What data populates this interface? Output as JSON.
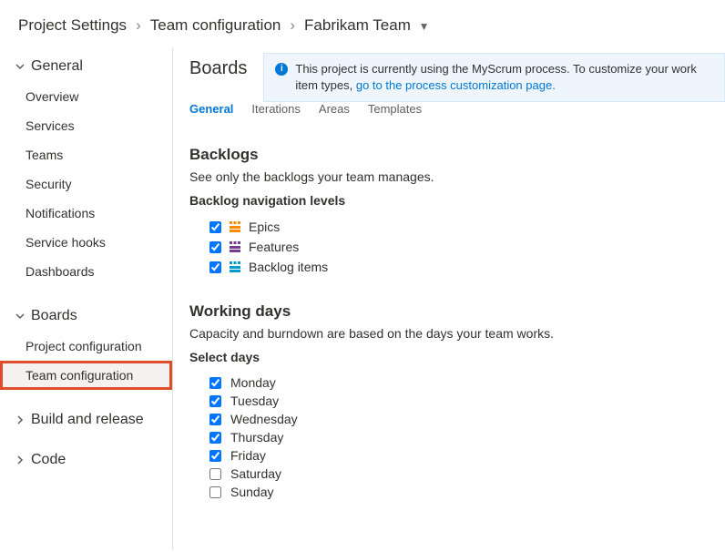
{
  "breadcrumb": {
    "root": "Project Settings",
    "mid": "Team configuration",
    "leaf": "Fabrikam Team"
  },
  "sidebar": {
    "groups": [
      {
        "label": "General",
        "expanded": true,
        "items": [
          {
            "label": "Overview"
          },
          {
            "label": "Services"
          },
          {
            "label": "Teams"
          },
          {
            "label": "Security"
          },
          {
            "label": "Notifications"
          },
          {
            "label": "Service hooks"
          },
          {
            "label": "Dashboards"
          }
        ]
      },
      {
        "label": "Boards",
        "expanded": true,
        "items": [
          {
            "label": "Project configuration"
          },
          {
            "label": "Team configuration",
            "active": true,
            "highlighted": true
          }
        ]
      },
      {
        "label": "Build and release",
        "expanded": false,
        "items": []
      },
      {
        "label": "Code",
        "expanded": false,
        "items": []
      }
    ]
  },
  "page": {
    "title": "Boards",
    "info_prefix": "This project is currently using the MyScrum process. To customize your work item types, ",
    "info_link": "go to the process customization page.",
    "tabs": [
      {
        "label": "General",
        "active": true
      },
      {
        "label": "Iterations"
      },
      {
        "label": "Areas"
      },
      {
        "label": "Templates"
      }
    ]
  },
  "backlogs": {
    "heading": "Backlogs",
    "subtitle": "See only the backlogs your team manages.",
    "nav_label": "Backlog navigation levels",
    "levels": [
      {
        "label": "Epics",
        "checked": true,
        "color": "#ff8c00"
      },
      {
        "label": "Features",
        "checked": true,
        "color": "#773b93"
      },
      {
        "label": "Backlog items",
        "checked": true,
        "color": "#009ccc"
      }
    ]
  },
  "workingDays": {
    "heading": "Working days",
    "subtitle": "Capacity and burndown are based on the days your team works.",
    "select_label": "Select days",
    "days": [
      {
        "label": "Monday",
        "checked": true
      },
      {
        "label": "Tuesday",
        "checked": true
      },
      {
        "label": "Wednesday",
        "checked": true
      },
      {
        "label": "Thursday",
        "checked": true
      },
      {
        "label": "Friday",
        "checked": true
      },
      {
        "label": "Saturday",
        "checked": false
      },
      {
        "label": "Sunday",
        "checked": false
      }
    ]
  }
}
